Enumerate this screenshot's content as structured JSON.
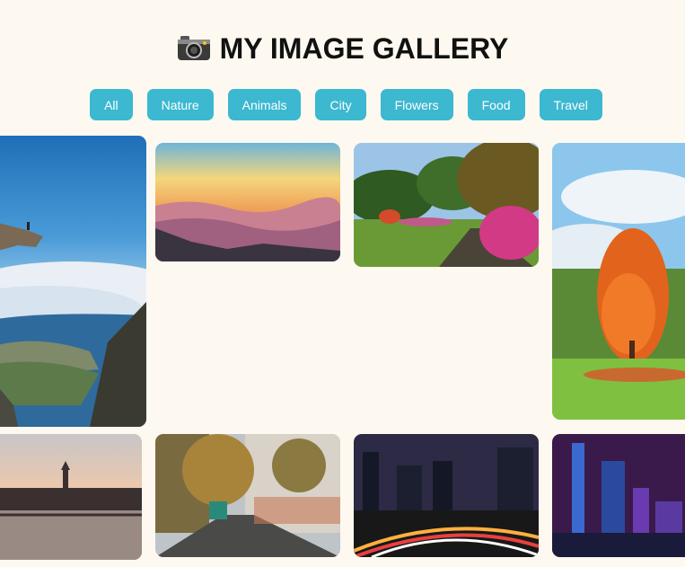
{
  "header": {
    "title": "MY IMAGE GALLERY",
    "icon": "camera-icon"
  },
  "filters": [
    {
      "label": "All"
    },
    {
      "label": "Nature"
    },
    {
      "label": "Animals"
    },
    {
      "label": "City"
    },
    {
      "label": "Flowers"
    },
    {
      "label": "Food"
    },
    {
      "label": "Travel"
    }
  ],
  "colors": {
    "accent": "#3cb8d0",
    "background": "#fdf9f0"
  }
}
